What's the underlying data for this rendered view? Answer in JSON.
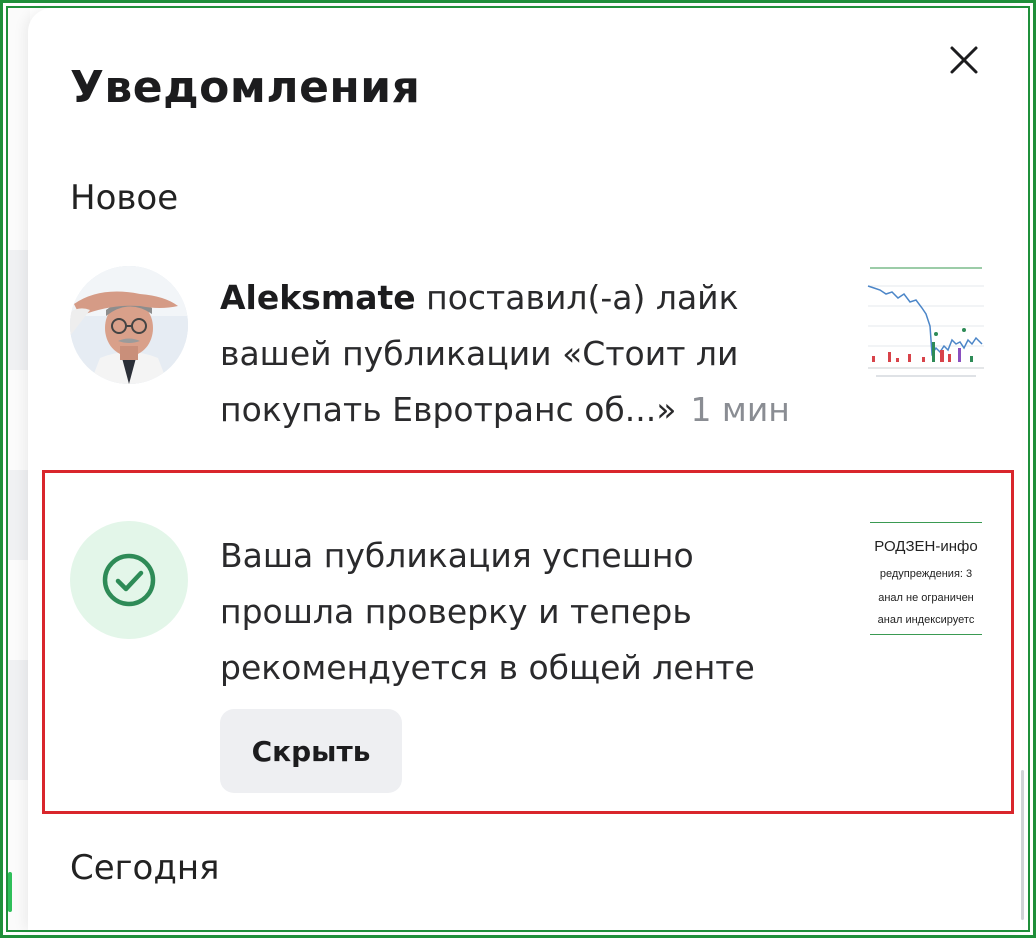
{
  "panel": {
    "title": "Уведомления",
    "close_icon": "close-icon"
  },
  "sections": {
    "new_label": "Новое",
    "today_label": "Сегодня"
  },
  "like_notification": {
    "user": "Aleksmate",
    "action": "поставил(-а) лайк",
    "line2": "вашей публикации «Стоит ли",
    "line3": "покупать Евротранс об...»",
    "time": "1 мин",
    "avatar_icon": "user-avatar",
    "thumbnail_icon": "chart-thumbnail"
  },
  "moderation_notification": {
    "line1": "Ваша публикация успешно",
    "line2": "прошла проверку и теперь",
    "line3": "рекомендуется в общей ленте",
    "hide_label": "Скрыть",
    "status_icon": "check-circle-icon",
    "thumbnail": {
      "title": "РОДЗЕН-инфо",
      "row1": "редупреждения: 3",
      "row2": "анал не ограничен",
      "row3": "анал индексируетс"
    }
  },
  "colors": {
    "frame": "#1f8f3a",
    "highlight": "#d9262c",
    "success": "#2e8b57",
    "success_bg": "#e3f6e9",
    "button_bg": "#eeeff2",
    "muted_text": "#8a8d93"
  }
}
